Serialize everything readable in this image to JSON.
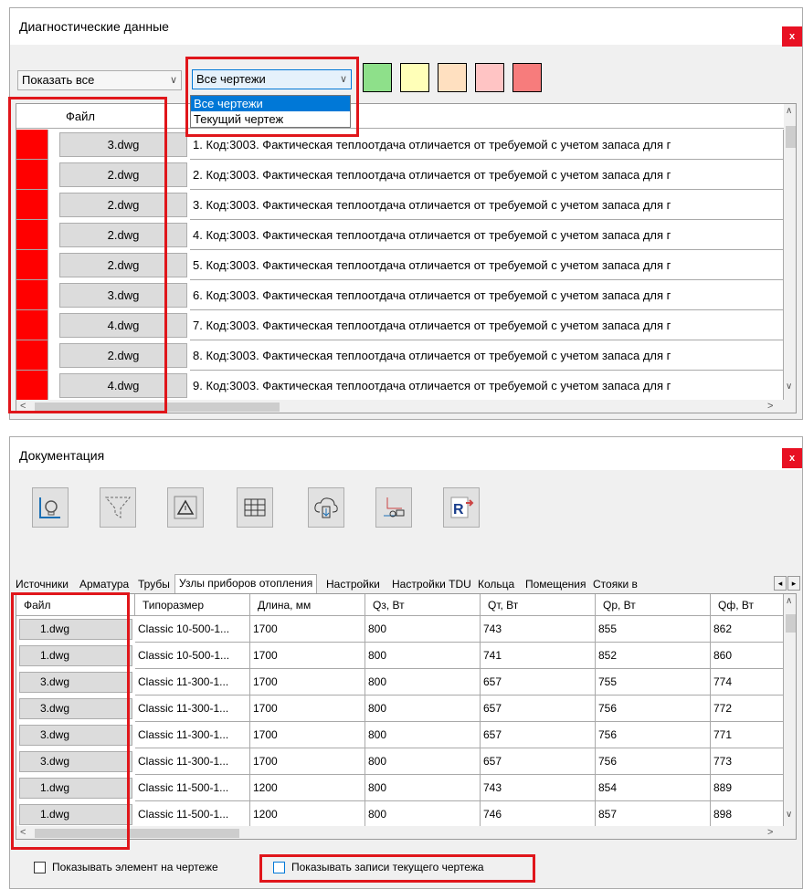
{
  "diag": {
    "title": "Диагностические данные",
    "close": "x",
    "filter": "Показать все",
    "drawing_select": "Все чертежи",
    "drawing_options": [
      "Все чертежи",
      "Текущий чертеж"
    ],
    "swatches": [
      "#8ee08a",
      "#ffffb8",
      "#ffe0c0",
      "#ffc4c4",
      "#f77c7c"
    ],
    "col_file": "Файл",
    "rows": [
      {
        "file": "3.dwg",
        "msg": "1. Код:3003. Фактическая теплоотдача отличается от требуемой с учетом запаса для г"
      },
      {
        "file": "2.dwg",
        "msg": "2. Код:3003. Фактическая теплоотдача отличается от требуемой с учетом запаса для г"
      },
      {
        "file": "2.dwg",
        "msg": "3. Код:3003. Фактическая теплоотдача отличается от требуемой с учетом запаса для г"
      },
      {
        "file": "2.dwg",
        "msg": "4. Код:3003. Фактическая теплоотдача отличается от требуемой с учетом запаса для г"
      },
      {
        "file": "2.dwg",
        "msg": "5. Код:3003. Фактическая теплоотдача отличается от требуемой с учетом запаса для г"
      },
      {
        "file": "3.dwg",
        "msg": "6. Код:3003. Фактическая теплоотдача отличается от требуемой с учетом запаса для г"
      },
      {
        "file": "4.dwg",
        "msg": "7. Код:3003. Фактическая теплоотдача отличается от требуемой с учетом запаса для г"
      },
      {
        "file": "2.dwg",
        "msg": "8. Код:3003. Фактическая теплоотдача отличается от требуемой с учетом запаса для г"
      },
      {
        "file": "4.dwg",
        "msg": "9. Код:3003. Фактическая теплоотдача отличается от требуемой с учетом запаса для г"
      }
    ],
    "severity_color": "#ff0000"
  },
  "doc": {
    "title": "Документация",
    "close": "x",
    "tools": [
      "source-icon",
      "filter-icon",
      "warning-icon",
      "table-icon",
      "cloud-download-icon",
      "pipe-node-icon",
      "revit-export-icon"
    ],
    "tabs": [
      "Источники",
      "Арматура",
      "Трубы",
      "Узлы приборов отопления",
      "Настройки",
      "Настройки TDU",
      "Кольца",
      "Помещения",
      "Стояки в"
    ],
    "active_tab": 3,
    "columns": [
      "Файл",
      "Типоразмер",
      "Длина, мм",
      "Qз, Вт",
      "Qт, Вт",
      "Qр, Вт",
      "Qф, Вт"
    ],
    "rows": [
      [
        "1.dwg",
        "Classic 10-500-1...",
        "1700",
        "800",
        "743",
        "855",
        "862"
      ],
      [
        "1.dwg",
        "Classic 10-500-1...",
        "1700",
        "800",
        "741",
        "852",
        "860"
      ],
      [
        "3.dwg",
        "Classic 11-300-1...",
        "1700",
        "800",
        "657",
        "755",
        "774"
      ],
      [
        "3.dwg",
        "Classic 11-300-1...",
        "1700",
        "800",
        "657",
        "756",
        "772"
      ],
      [
        "3.dwg",
        "Classic 11-300-1...",
        "1700",
        "800",
        "657",
        "756",
        "771"
      ],
      [
        "3.dwg",
        "Classic 11-300-1...",
        "1700",
        "800",
        "657",
        "756",
        "773"
      ],
      [
        "1.dwg",
        "Classic 11-500-1...",
        "1200",
        "800",
        "743",
        "854",
        "889"
      ],
      [
        "1.dwg",
        "Classic 11-500-1...",
        "1200",
        "800",
        "746",
        "857",
        "898"
      ]
    ],
    "show_element": "Показывать элемент на чертеже",
    "show_current": "Показывать записи текущего чертежа"
  }
}
